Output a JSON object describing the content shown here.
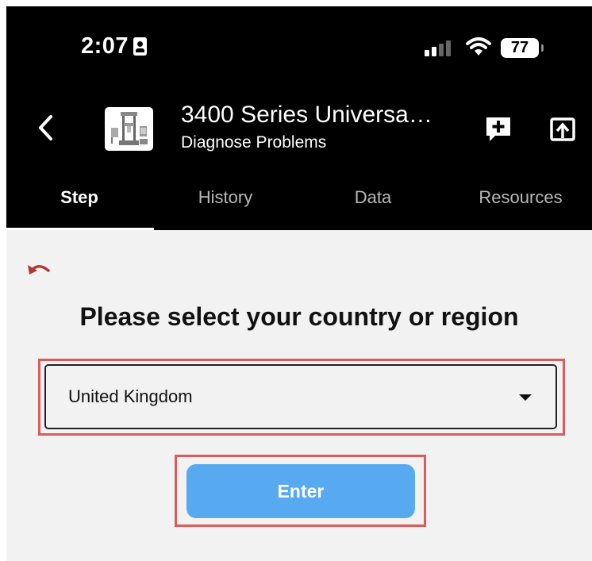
{
  "status_bar": {
    "time": "2:07",
    "battery": "77"
  },
  "header": {
    "title": "3400 Series Universa…",
    "subtitle": "Diagnose Problems"
  },
  "tabs": [
    {
      "label": "Step",
      "active": true
    },
    {
      "label": "History",
      "active": false
    },
    {
      "label": "Data",
      "active": false
    },
    {
      "label": "Resources",
      "active": false
    }
  ],
  "main": {
    "heading": "Please select your country or region",
    "country_select_value": "United Kingdom",
    "enter_label": "Enter"
  },
  "colors": {
    "accent_button": "#57aaf0",
    "highlight_box": "#e05a5a",
    "undo_icon": "#b03a3a"
  }
}
